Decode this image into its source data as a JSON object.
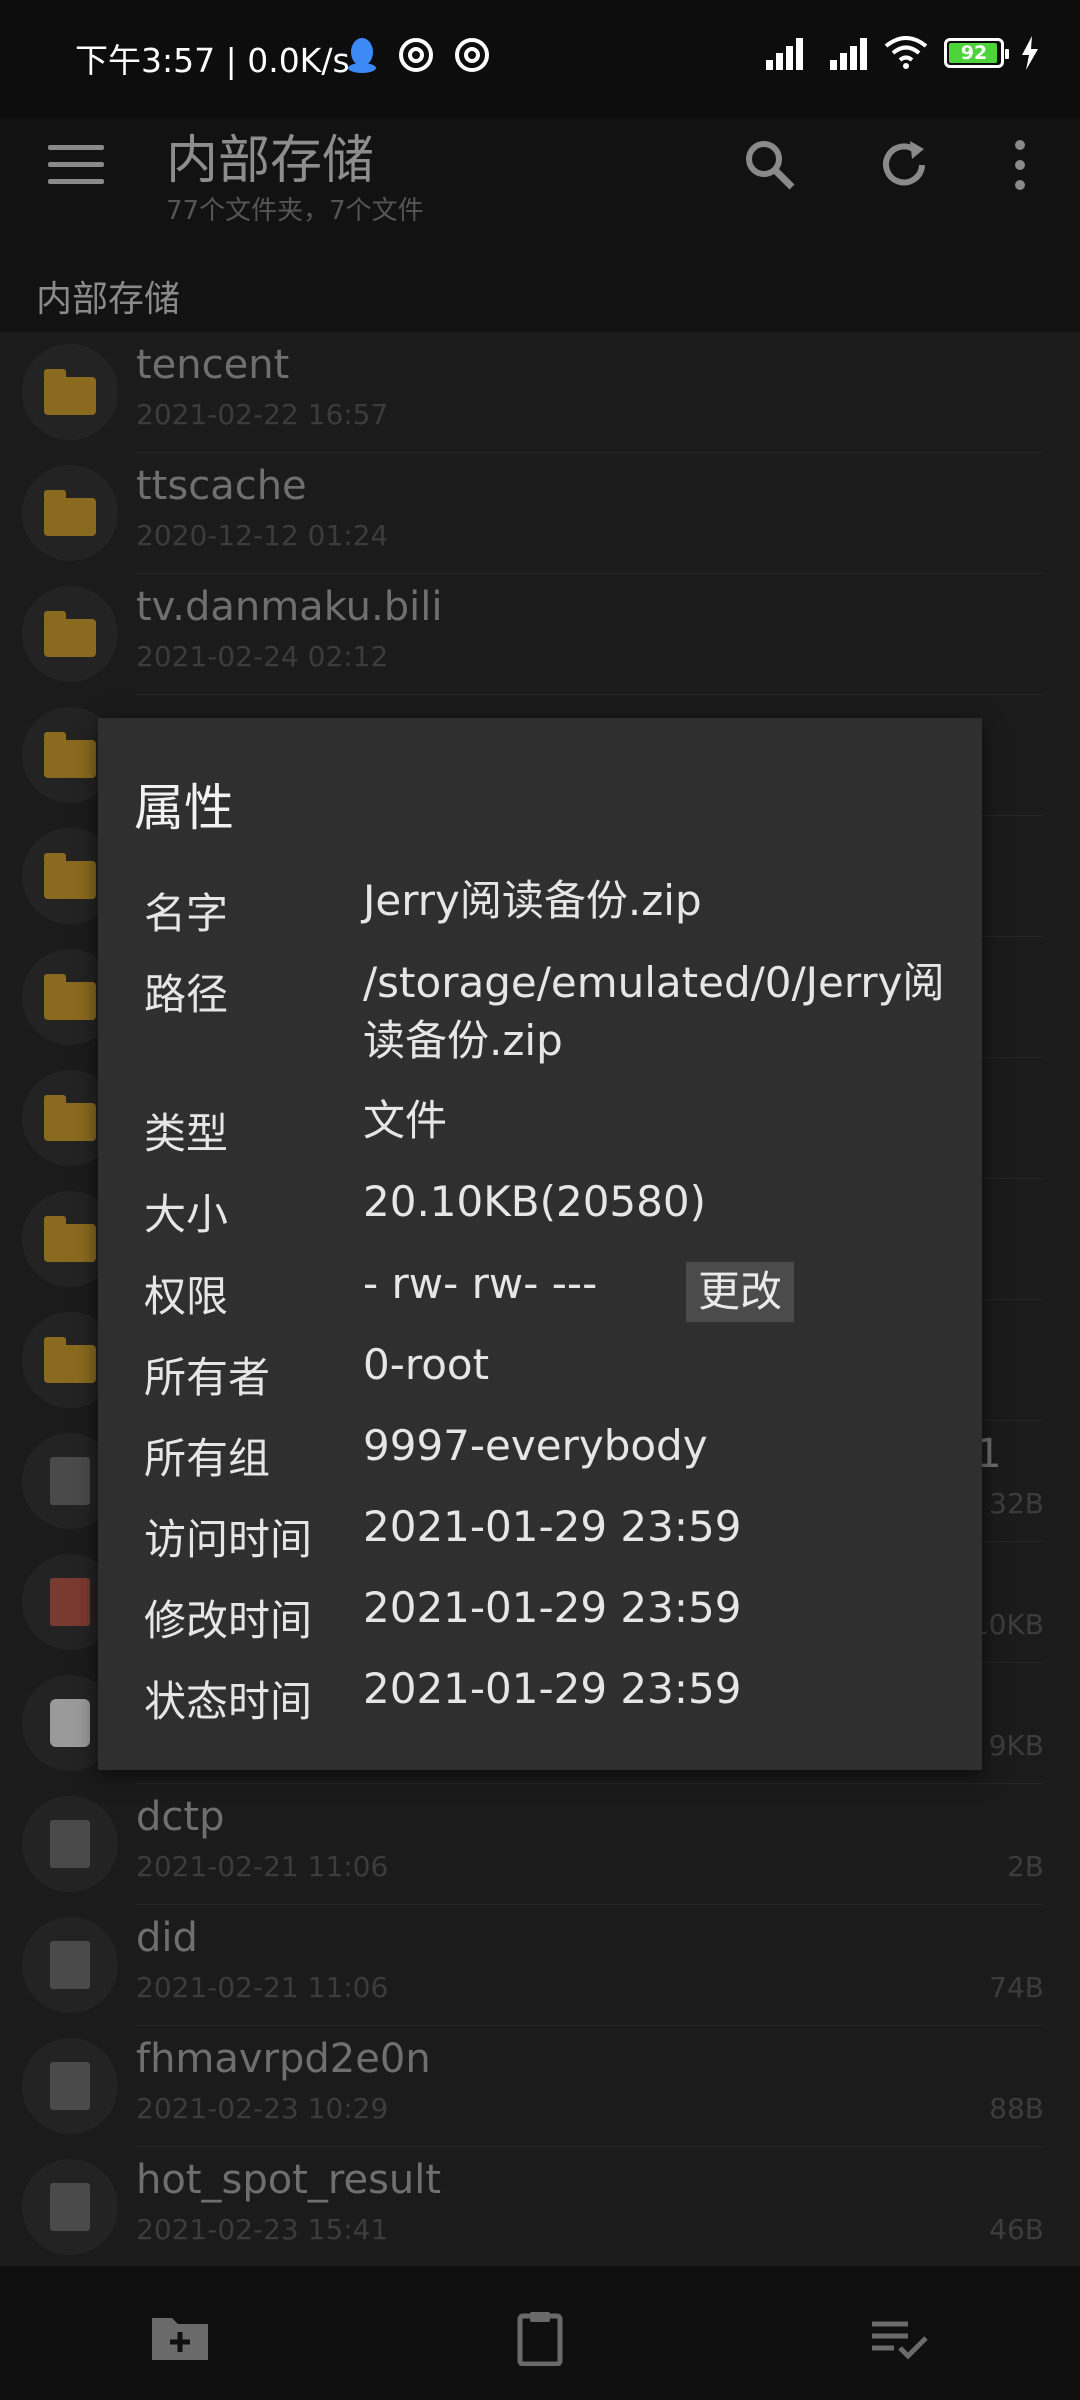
{
  "status_bar": {
    "time_speed": "下午3:57 | 0.0K/s",
    "battery": "92"
  },
  "toolbar": {
    "title": "内部存储",
    "subtitle": "77个文件夹，7个文件"
  },
  "breadcrumb": "内部存储",
  "files": [
    {
      "name": "tencent",
      "date": "2021-02-22 16:57",
      "size": "",
      "type": "folder"
    },
    {
      "name": "ttscache",
      "date": "2020-12-12 01:24",
      "size": "",
      "type": "folder"
    },
    {
      "name": "tv.danmaku.bili",
      "date": "2021-02-24 02:12",
      "size": "",
      "type": "folder"
    },
    {
      "name": "",
      "date": "",
      "size": "",
      "type": "folder"
    },
    {
      "name": "",
      "date": "",
      "size": "",
      "type": "folder"
    },
    {
      "name": "",
      "date": "",
      "size": "",
      "type": "folder"
    },
    {
      "name": "",
      "date": "",
      "size": "",
      "type": "folder"
    },
    {
      "name": "",
      "date": "",
      "size": "",
      "type": "folder"
    },
    {
      "name": "",
      "date": "",
      "size": "",
      "type": "folder"
    },
    {
      "name": "1",
      "date": "",
      "size": "32B",
      "type": "file"
    },
    {
      "name": "",
      "date": "",
      "size": "10KB",
      "type": "archive"
    },
    {
      "name": "",
      "date": "",
      "size": "9KB",
      "type": "image"
    },
    {
      "name": "dctp",
      "date": "2021-02-21 11:06",
      "size": "2B",
      "type": "file"
    },
    {
      "name": "did",
      "date": "2021-02-21 11:06",
      "size": "74B",
      "type": "file"
    },
    {
      "name": "fhmavrpd2e0n",
      "date": "2021-02-23 10:29",
      "size": "88B",
      "type": "file"
    },
    {
      "name": "hot_spot_result",
      "date": "2021-02-23 15:41",
      "size": "46B",
      "type": "file"
    }
  ],
  "dialog": {
    "title": "属性",
    "labels": {
      "name": "名字",
      "path": "路径",
      "type": "类型",
      "size": "大小",
      "perm": "权限",
      "owner": "所有者",
      "group": "所有组",
      "atime": "访问时间",
      "mtime": "修改时间",
      "ctime": "状态时间"
    },
    "values": {
      "name": "Jerry阅读备份.zip",
      "path": "/storage/emulated/0/Jerry阅读备份.zip",
      "type": "文件",
      "size": "20.10KB(20580)",
      "perm": "- rw- rw- ---",
      "owner": "0-root",
      "group": "9997-everybody",
      "atime": "2021-01-29 23:59",
      "mtime": "2021-01-29 23:59",
      "ctime": "2021-01-29 23:59"
    },
    "change_label": "更改"
  }
}
